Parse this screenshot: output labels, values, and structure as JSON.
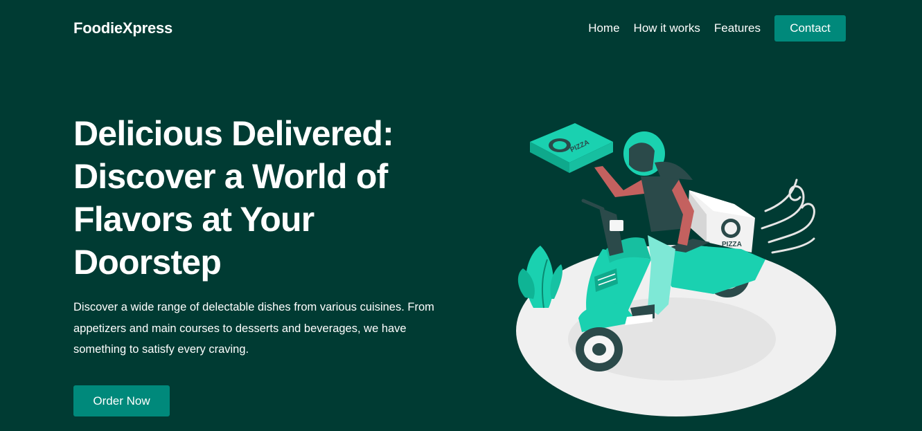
{
  "header": {
    "brand": "FoodieXpress",
    "nav": {
      "home": "Home",
      "how_it_works": "How it works",
      "features": "Features",
      "contact": "Contact"
    }
  },
  "hero": {
    "title": "Delicious Delivered: Discover a World of Flavors at Your Doorstep",
    "description": "Discover a wide range of delectable dishes from various cuisines. From appetizers and main courses to desserts and beverages, we have something to satisfy every craving.",
    "cta_label": "Order Now"
  },
  "illustration": {
    "box_label": "PIZZA",
    "icons": [
      "pizza-box-icon",
      "scooter-icon",
      "wind-swirl-icon",
      "plant-icon"
    ]
  },
  "colors": {
    "background": "#003b33",
    "accent": "#00897b",
    "illustration_teal": "#1ad1b0",
    "text": "#ffffff"
  }
}
